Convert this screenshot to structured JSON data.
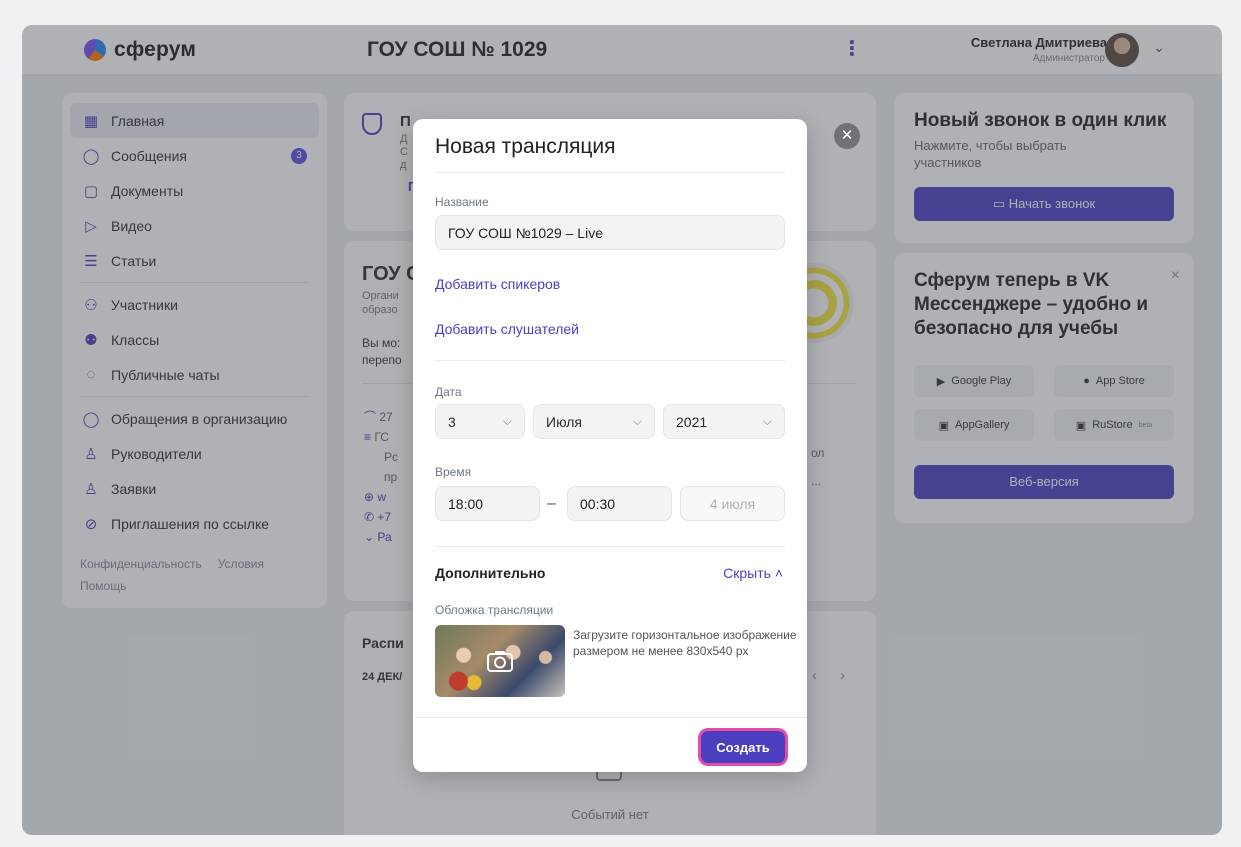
{
  "app": {
    "logo_text": "сферум",
    "org_title": "ГОУ СОШ № 1029",
    "user": {
      "name": "Светлана Дмитриева",
      "role": "Администратор"
    }
  },
  "sidebar": {
    "items": [
      {
        "label": "Главная",
        "icon": "home-grid-icon"
      },
      {
        "label": "Сообщения",
        "icon": "chat-bubble-icon",
        "badge": "3"
      },
      {
        "label": "Документы",
        "icon": "document-icon"
      },
      {
        "label": "Видео",
        "icon": "play-circle-icon"
      },
      {
        "label": "Статьи",
        "icon": "article-icon"
      },
      {
        "label": "Участники",
        "icon": "users-icon"
      },
      {
        "label": "Классы",
        "icon": "classes-icon"
      },
      {
        "label": "Публичные чаты",
        "icon": "public-chat-icon"
      },
      {
        "label": "Обращения в организацию",
        "icon": "appeal-icon"
      },
      {
        "label": "Руководители",
        "icon": "person-icon"
      },
      {
        "label": "Заявки",
        "icon": "person-add-icon"
      },
      {
        "label": "Приглашения по ссылке",
        "icon": "link-icon"
      }
    ],
    "footer": {
      "privacy": "Конфиденциальность",
      "terms": "Условия",
      "help": "Помощь"
    }
  },
  "background": {
    "card1": {
      "title_fragment": "П",
      "text_fragments": [
        "Д",
        "С",
        "д"
      ],
      "link_fragment": "П"
    },
    "card2": {
      "title_fragment": "ГОУ С",
      "sub_fragments": [
        "Органи",
        "образо"
      ],
      "body_fragments": [
        "Вы мо:",
        "перепо"
      ],
      "details": [
        "27",
        "ГС",
        "Рс",
        "пр",
        "w",
        "+7",
        "Ра"
      ],
      "right_fragments": [
        "ол",
        "..."
      ]
    },
    "card3": {
      "title_fragment": "Распи",
      "date_fragment": "24 ДЕК/",
      "empty_text": "Событий нет"
    }
  },
  "right_panel": {
    "call": {
      "title": "Новый звонок в один клик",
      "subtitle": "Нажмите, чтобы выбрать участников",
      "button": "Начать звонок"
    },
    "promo": {
      "title": "Сферум теперь в VK Мессенджере – удобно и безопасно для учебы",
      "stores": [
        "Google Play",
        "App Store",
        "AppGallery",
        "RuStore"
      ],
      "store_suffix": "beta",
      "web_button": "Веб-версия"
    }
  },
  "modal": {
    "title": "Новая трансляция",
    "name_label": "Название",
    "name_value": "ГОУ СОШ №1029 – Live",
    "add_speakers": "Добавить спикеров",
    "add_listeners": "Добавить слушателей",
    "date_label": "Дата",
    "date": {
      "day": "3",
      "month": "Июля",
      "year": "2021"
    },
    "time_label": "Время",
    "time": {
      "start": "18:00",
      "separator": "–",
      "end": "00:30",
      "end_date": "4 июля"
    },
    "section_title": "Дополнительно",
    "hide_link": "Скрыть",
    "cover_label": "Обложка трансляции",
    "cover_hint": "Загрузите горизонтальное изображение размером не менее 830x540 px",
    "create_button": "Создать"
  },
  "colors": {
    "accent": "#4b3fbf",
    "highlight": "#e24fa3"
  }
}
